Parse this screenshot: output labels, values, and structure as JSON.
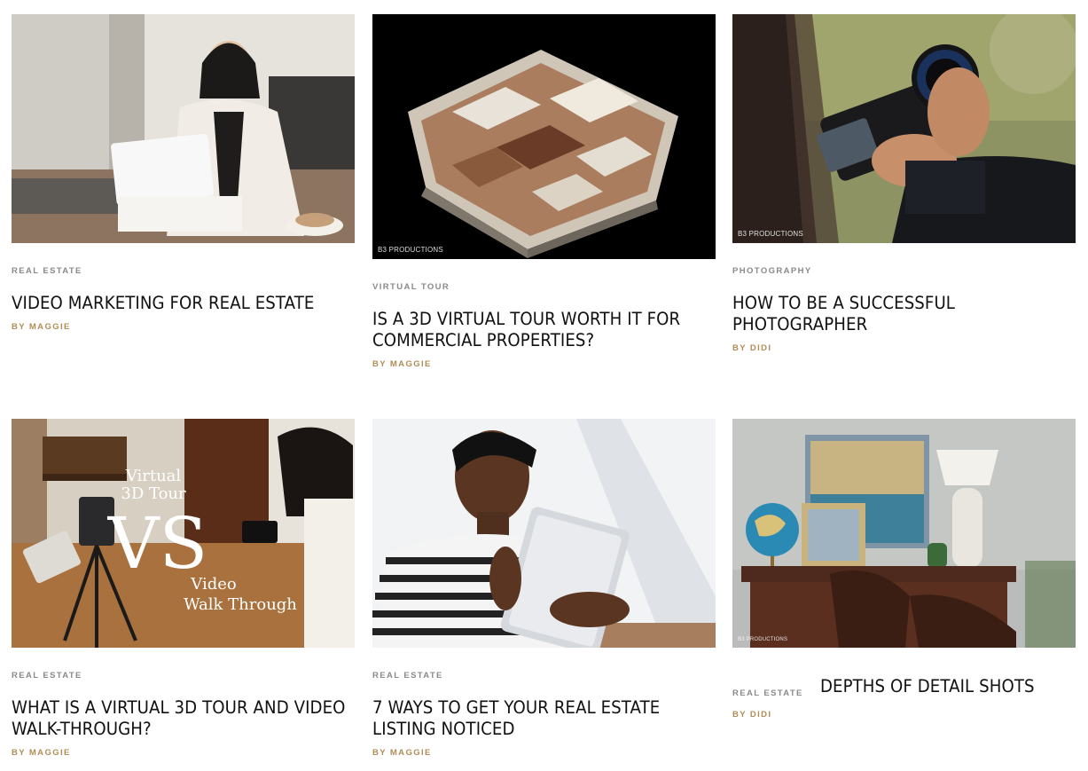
{
  "posts": [
    {
      "category": "REAL ESTATE",
      "title": "VIDEO MARKETING FOR REAL ESTATE",
      "author": "BY MAGGIE",
      "image_desc": "woman-with-tablet-photo",
      "watermark": ""
    },
    {
      "category": "VIRTUAL TOUR",
      "title_lines": [
        "IS A 3D VIRTUAL TOUR WORTH IT FOR",
        "COMMERCIAL PROPERTIES?"
      ],
      "author": "BY MAGGIE",
      "image_desc": "3d-dollhouse-floorplan-photo",
      "watermark": "B3 PRODUCTIONS"
    },
    {
      "category": "PHOTOGRAPHY",
      "title_lines": [
        "HOW TO BE A SUCCESSFUL",
        "PHOTOGRAPHER"
      ],
      "author": "BY DIDI",
      "image_desc": "person-holding-camera-photo",
      "watermark": "B3 PRODUCTIONS"
    },
    {
      "category": "REAL ESTATE",
      "title_lines": [
        "WHAT IS A VIRTUAL 3D TOUR AND VIDEO",
        "WALK-THROUGH?"
      ],
      "author": "BY MAGGIE",
      "image_desc": "virtual-tour-vs-video-photo",
      "overlay": {
        "top": "Virtual",
        "mid": "3D Tour",
        "vs": "VS",
        "bottom1": "Video",
        "bottom2": "Walk Through"
      }
    },
    {
      "category": "REAL ESTATE",
      "title_lines": [
        "7 WAYS TO GET YOUR REAL ESTATE",
        "LISTING NOTICED"
      ],
      "author": "BY MAGGIE",
      "image_desc": "woman-reading-tablet-photo"
    },
    {
      "category": "REAL ESTATE",
      "title": "DEPTHS OF DETAIL SHOTS",
      "author": "BY DIDI",
      "image_desc": "interior-detail-shot-photo",
      "watermark": "B3 PRODUCTIONS"
    }
  ],
  "colors": {
    "category": "#8a8a8a",
    "author": "#b08c57",
    "title": "#111111"
  }
}
